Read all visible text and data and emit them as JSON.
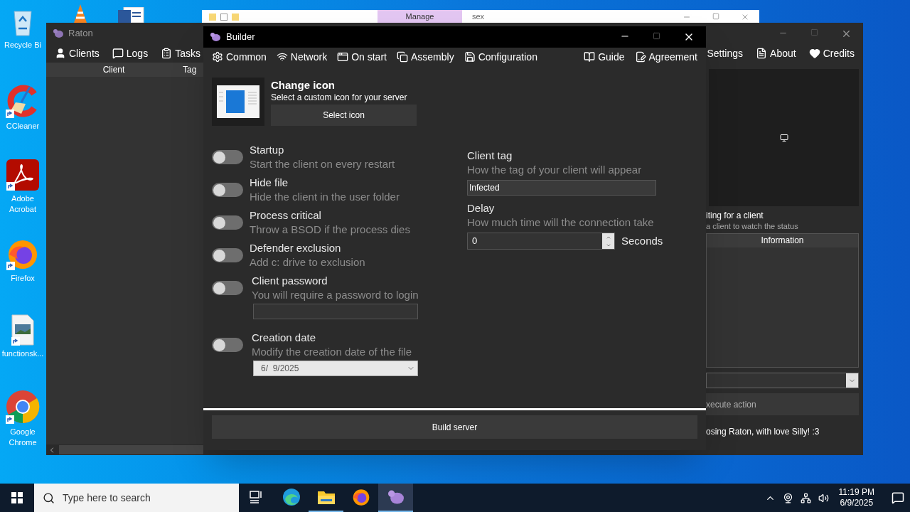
{
  "desktop_icons": [
    {
      "kind": "recycle",
      "label": "Recycle Bi"
    },
    {
      "kind": "ccleaner",
      "label": "CCleaner"
    },
    {
      "kind": "acrobat",
      "label": "Adobe Acrobat"
    },
    {
      "kind": "firefox",
      "label": "Firefox"
    },
    {
      "kind": "image",
      "label": "functionsk..."
    },
    {
      "kind": "chrome",
      "label": "Google Chrome"
    }
  ],
  "background_window": {
    "ribbon_tab": "Manage",
    "path_text": "sex"
  },
  "raton": {
    "title": "Raton",
    "menu_left": [
      {
        "kind": "user",
        "label": "Clients"
      },
      {
        "kind": "logs",
        "label": "Logs"
      },
      {
        "kind": "tasks",
        "label": "Tasks"
      }
    ],
    "menu_right": [
      {
        "kind": "none",
        "label": "Settings"
      },
      {
        "kind": "about",
        "label": "About"
      },
      {
        "kind": "heart",
        "label": "Credits"
      }
    ],
    "columns": [
      "Client",
      "Tag"
    ],
    "status_title": "iting for a client",
    "status_subtitle": "a client to watch the status",
    "info_header": "Information",
    "action_button": "xecute action",
    "footer": "osing Raton, with love Silly! :3"
  },
  "builder": {
    "title": "Builder",
    "menu_left": [
      {
        "kind": "gear",
        "label": "Common"
      },
      {
        "kind": "network",
        "label": "Network"
      },
      {
        "kind": "window",
        "label": "On start"
      },
      {
        "kind": "copy",
        "label": "Assembly"
      },
      {
        "kind": "save",
        "label": "Configuration"
      }
    ],
    "menu_right": [
      {
        "kind": "guide",
        "label": "Guide"
      },
      {
        "kind": "agreement",
        "label": "Agreement"
      }
    ],
    "change_icon": {
      "title": "Change icon",
      "subtitle": "Select a custom icon for your server",
      "button": "Select icon"
    },
    "toggles": [
      {
        "title": "Startup",
        "description": "Start the client on every restart",
        "on": false
      },
      {
        "title": "Hide file",
        "description": "Hide the client in the user folder",
        "on": false
      },
      {
        "title": "Process critical",
        "description": "Throw a BSOD if the process dies",
        "on": false
      },
      {
        "title": "Defender exclusion",
        "description": "Add c: drive to exclusion",
        "on": false
      },
      {
        "title": "Client password",
        "description": "You will require a password to login",
        "on": false,
        "kind": "password"
      },
      {
        "title": "Creation date",
        "description": "Modify the creation date of the file",
        "on": false,
        "kind": "date",
        "value": "6/  9/2025"
      }
    ],
    "client_tag": {
      "label": "Client tag",
      "description": "How the tag of your client will appear",
      "value": "Infected"
    },
    "delay": {
      "label": "Delay",
      "description": "How much time will the connection take",
      "value": "0",
      "unit": "Seconds"
    },
    "build_button": "Build server"
  },
  "taskbar": {
    "search_placeholder": "Type here to search",
    "apps": [
      {
        "kind": "taskview",
        "running": false,
        "selected": false
      },
      {
        "kind": "edge",
        "running": false,
        "selected": false
      },
      {
        "kind": "explorer",
        "running": true,
        "selected": false
      },
      {
        "kind": "firefox",
        "running": false,
        "selected": false
      },
      {
        "kind": "raton",
        "running": true,
        "selected": true
      }
    ],
    "time": "11:19 PM",
    "date": "6/9/2025"
  }
}
